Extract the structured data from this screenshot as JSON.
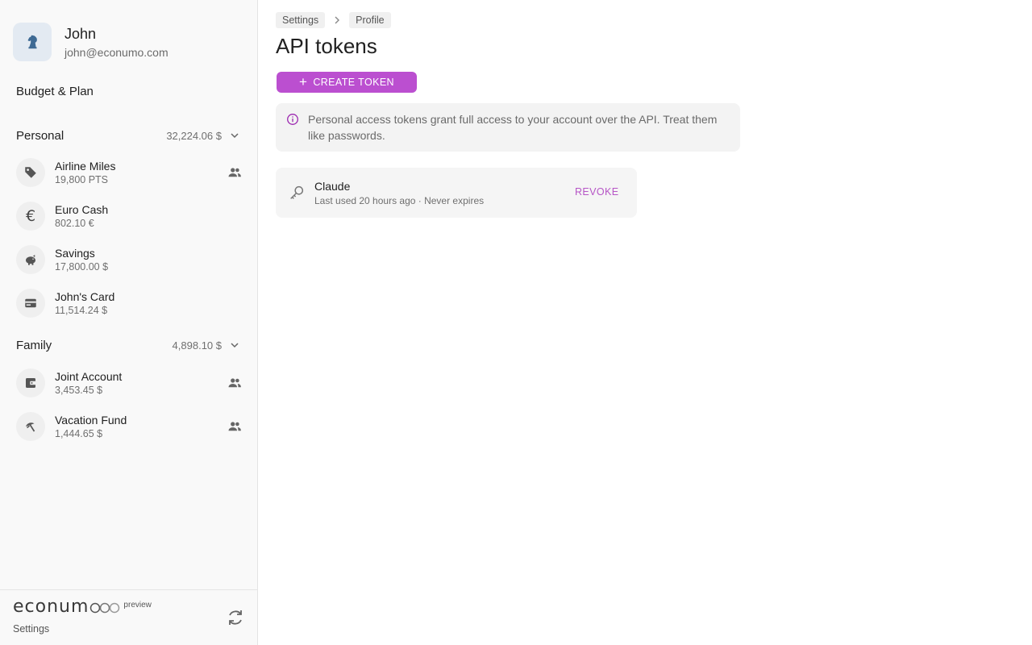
{
  "user": {
    "name": "John",
    "email": "john@econumo.com"
  },
  "nav": {
    "budget_label": "Budget & Plan"
  },
  "groups": [
    {
      "name": "Personal",
      "total": "32,224.06 $",
      "accounts": [
        {
          "name": "Airline Miles",
          "balance": "19,800 PTS",
          "icon": "tag-icon",
          "shared": true
        },
        {
          "name": "Euro Cash",
          "balance": "802.10 €",
          "icon": "euro-icon",
          "shared": false
        },
        {
          "name": "Savings",
          "balance": "17,800.00 $",
          "icon": "piggy-bank-icon",
          "shared": false
        },
        {
          "name": "John's Card",
          "balance": "11,514.24 $",
          "icon": "credit-card-icon",
          "shared": false
        }
      ]
    },
    {
      "name": "Family",
      "total": "4,898.10 $",
      "accounts": [
        {
          "name": "Joint Account",
          "balance": "3,453.45 $",
          "icon": "wallet-icon",
          "shared": true
        },
        {
          "name": "Vacation Fund",
          "balance": "1,444.65 $",
          "icon": "beach-umbrella-icon",
          "shared": true
        }
      ]
    }
  ],
  "footer": {
    "brand": "econum",
    "preview_label": "preview",
    "settings_label": "Settings"
  },
  "breadcrumb": [
    "Settings",
    "Profile"
  ],
  "page": {
    "title": "API tokens",
    "create_label": "CREATE TOKEN",
    "info_text": "Personal access tokens grant full access to your account over the API. Treat them like passwords."
  },
  "tokens": [
    {
      "name": "Claude",
      "meta": "Last used 20 hours ago · Never expires",
      "revoke_label": "REVOKE"
    }
  ],
  "colors": {
    "accent": "#bb4fd0",
    "revoke": "#b655c6",
    "info_icon": "#9c27b0",
    "sidebar_bg": "#f9f9f9"
  }
}
